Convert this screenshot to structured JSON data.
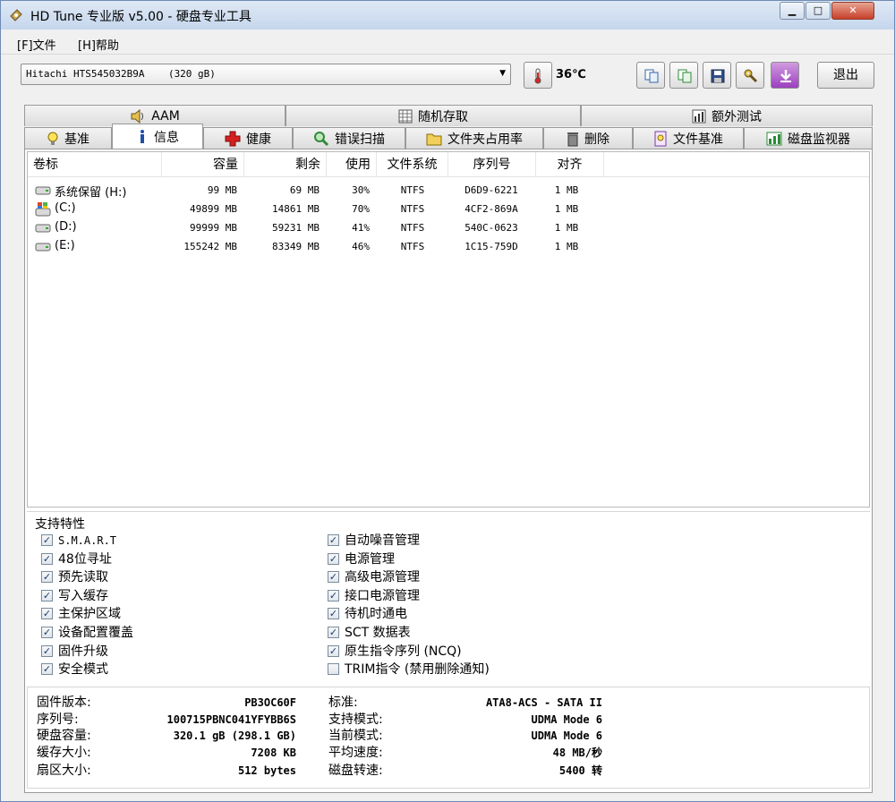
{
  "window": {
    "title": "HD Tune 专业版 v5.00 - 硬盘专业工具"
  },
  "menu": {
    "file": "[F]文件",
    "help": "[H]帮助"
  },
  "toolbar": {
    "drive": "Hitachi HTS545032B9A    (320 gB)",
    "temperature": "36℃",
    "exit_label": "退出"
  },
  "tabs": {
    "row1": [
      "AAM",
      "随机存取",
      "额外测试"
    ],
    "row2": [
      "基准",
      "信息",
      "健康",
      "错误扫描",
      "文件夹占用率",
      "删除",
      "文件基准",
      "磁盘监视器"
    ],
    "active": "信息"
  },
  "partitions": {
    "columns": [
      "卷标",
      "容量",
      "剩余",
      "使用",
      "文件系统",
      "序列号",
      "对齐"
    ],
    "rows": [
      {
        "name": "系统保留 (H:)",
        "capacity": "99 MB",
        "free": "69 MB",
        "used": "30%",
        "fs": "NTFS",
        "serial": "D6D9-6221",
        "align": "1 MB",
        "icon": "drive-icon"
      },
      {
        "name": "(C:)",
        "capacity": "49899 MB",
        "free": "14861 MB",
        "used": "70%",
        "fs": "NTFS",
        "serial": "4CF2-869A",
        "align": "1 MB",
        "icon": "windows-drive-icon"
      },
      {
        "name": "(D:)",
        "capacity": "99999 MB",
        "free": "59231 MB",
        "used": "41%",
        "fs": "NTFS",
        "serial": "540C-0623",
        "align": "1 MB",
        "icon": "drive-icon"
      },
      {
        "name": "(E:)",
        "capacity": "155242 MB",
        "free": "83349 MB",
        "used": "46%",
        "fs": "NTFS",
        "serial": "1C15-759D",
        "align": "1 MB",
        "icon": "drive-icon"
      }
    ]
  },
  "features": {
    "title": "支持特性",
    "left": [
      {
        "label": "S.M.A.R.T",
        "checked": true
      },
      {
        "label": "48位寻址",
        "checked": true
      },
      {
        "label": "预先读取",
        "checked": true
      },
      {
        "label": "写入缓存",
        "checked": true
      },
      {
        "label": "主保护区域",
        "checked": true
      },
      {
        "label": "设备配置覆盖",
        "checked": true
      },
      {
        "label": "固件升级",
        "checked": true
      },
      {
        "label": "安全模式",
        "checked": true
      }
    ],
    "right": [
      {
        "label": "自动噪音管理",
        "checked": true
      },
      {
        "label": "电源管理",
        "checked": true
      },
      {
        "label": "高级电源管理",
        "checked": true
      },
      {
        "label": "接口电源管理",
        "checked": true
      },
      {
        "label": "待机时通电",
        "checked": true
      },
      {
        "label": "SCT 数据表",
        "checked": true
      },
      {
        "label": "原生指令序列 (NCQ)",
        "checked": true
      },
      {
        "label": "TRIM指令 (禁用删除通知)",
        "checked": false
      }
    ]
  },
  "info": {
    "left": [
      {
        "label": "固件版本:",
        "value": "PB3OC60F"
      },
      {
        "label": "序列号:",
        "value": "100715PBNC041YFYBB6S"
      },
      {
        "label": "硬盘容量:",
        "value": "320.1 gB (298.1 GB)"
      },
      {
        "label": "缓存大小:",
        "value": "7208 KB"
      },
      {
        "label": "扇区大小:",
        "value": "512 bytes"
      }
    ],
    "right": [
      {
        "label": "标准:",
        "value": "ATA8-ACS - SATA II"
      },
      {
        "label": "支持模式:",
        "value": "UDMA Mode 6"
      },
      {
        "label": "当前模式:",
        "value": "UDMA Mode 6"
      },
      {
        "label": "平均速度:",
        "value": "48 MB/秒"
      },
      {
        "label": "磁盘转速:",
        "value": "5400 转"
      }
    ]
  }
}
